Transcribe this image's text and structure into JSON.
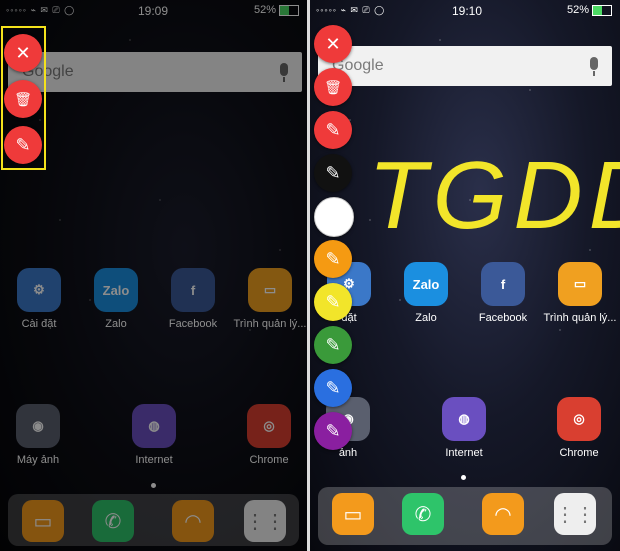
{
  "left": {
    "status": {
      "icons_left": "◦◦◦◦◦ ⌁ ✉ ⎚ ◯",
      "time": "19:09",
      "battery": "52%"
    },
    "search": {
      "logo": "Google"
    },
    "apps_row1": [
      {
        "label": "Cài đặt",
        "icon": "gear-icon",
        "color": "#3b78c8",
        "glyph": "⚙"
      },
      {
        "label": "Zalo",
        "icon": "zalo-icon",
        "color": "#1b8fe0",
        "glyph": "Zalo"
      },
      {
        "label": "Facebook",
        "icon": "facebook-icon",
        "color": "#3b5998",
        "glyph": "f"
      },
      {
        "label": "Trình quản lý...",
        "icon": "folder-icon",
        "color": "#f0a020",
        "glyph": "▭"
      }
    ],
    "apps_row2": [
      {
        "label": "Máy ảnh",
        "icon": "camera-icon",
        "color": "#5a5f6e",
        "glyph": "◉"
      },
      {
        "label": "Internet",
        "icon": "internet-icon",
        "color": "#6a4fc0",
        "glyph": "◍"
      },
      {
        "label": "Chrome",
        "icon": "chrome-icon",
        "color": "#d93f30",
        "glyph": "◎"
      }
    ],
    "tools": [
      {
        "name": "close",
        "glyph": "✕"
      },
      {
        "name": "delete",
        "glyph": "🗑"
      },
      {
        "name": "pen",
        "glyph": "✎"
      }
    ]
  },
  "right": {
    "status": {
      "icons_left": "◦◦◦◦◦ ⌁ ✉ ⎚ ◯",
      "time": "19:10",
      "battery": "52%"
    },
    "search": {
      "logo": "Google"
    },
    "drawing_text": "TGDD",
    "apps_row1": [
      {
        "label": "đặt",
        "icon": "gear-icon",
        "color": "#3b78c8",
        "glyph": "⚙"
      },
      {
        "label": "Zalo",
        "icon": "zalo-icon",
        "color": "#1b8fe0",
        "glyph": "Zalo"
      },
      {
        "label": "Facebook",
        "icon": "facebook-icon",
        "color": "#3b5998",
        "glyph": "f"
      },
      {
        "label": "Trình quản lý...",
        "icon": "folder-icon",
        "color": "#f0a020",
        "glyph": "▭"
      }
    ],
    "apps_row2": [
      {
        "label": "ảnh",
        "icon": "camera-icon",
        "color": "#5a5f6e",
        "glyph": "◉"
      },
      {
        "label": "Internet",
        "icon": "internet-icon",
        "color": "#6a4fc0",
        "glyph": "◍"
      },
      {
        "label": "Chrome",
        "icon": "chrome-icon",
        "color": "#d93f30",
        "glyph": "◎"
      }
    ],
    "tools": [
      {
        "name": "close",
        "glyph": "✕",
        "color": "#ef3a3a"
      },
      {
        "name": "delete",
        "glyph": "🗑",
        "color": "#ef3a3a"
      },
      {
        "name": "pen-red",
        "glyph": "✎",
        "color": "#ef3a3a"
      },
      {
        "name": "pen-black",
        "glyph": "✎",
        "color": "#111111"
      },
      {
        "name": "pen-white",
        "glyph": "",
        "color": "#ffffff"
      },
      {
        "name": "pen-orange",
        "glyph": "✎",
        "color": "#f59a12"
      },
      {
        "name": "pen-yellow",
        "glyph": "✎",
        "color": "#f2e52a"
      },
      {
        "name": "pen-green",
        "glyph": "✎",
        "color": "#3a9a3a"
      },
      {
        "name": "pen-blue",
        "glyph": "✎",
        "color": "#2a6fe0"
      },
      {
        "name": "pen-purple",
        "glyph": "✎",
        "color": "#8a1fa0"
      }
    ]
  },
  "dock": [
    {
      "icon": "message-icon",
      "color": "#f39a1c",
      "glyph": "▭"
    },
    {
      "icon": "phone-icon",
      "color": "#2ec46a",
      "glyph": "✆"
    },
    {
      "icon": "contacts-icon",
      "color": "#f39a1c",
      "glyph": "◠"
    },
    {
      "icon": "apps-icon",
      "color": "#eeeeee",
      "glyph": "⋮⋮"
    }
  ]
}
